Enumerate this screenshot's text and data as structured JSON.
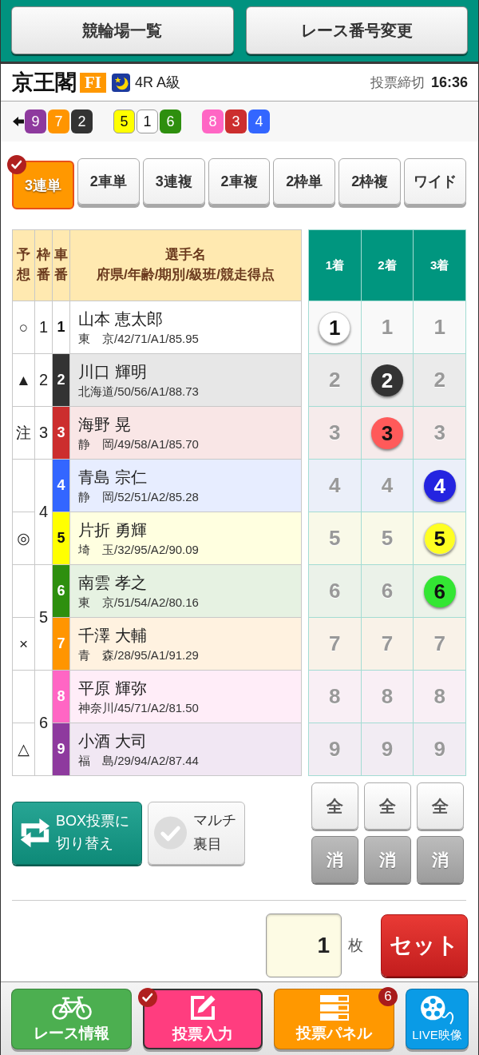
{
  "top_buttons": [
    {
      "label": "競輪場一覧"
    },
    {
      "label": "レース番号変更"
    }
  ],
  "race_header": {
    "venue": "京王閣",
    "grade": "FI",
    "night_race": true,
    "race": "4R A級",
    "deadline_label": "投票締切",
    "deadline_time": "16:36"
  },
  "lineup": {
    "groups": [
      {
        "bikes": [
          {
            "number": "9",
            "color": "#8e3a9e"
          },
          {
            "number": "7",
            "color": "#ff9500"
          },
          {
            "number": "2",
            "color": "#333333"
          }
        ]
      },
      {
        "bikes": [
          {
            "number": "5",
            "color": "#ffff00"
          },
          {
            "number": "1",
            "color": "#ffffff"
          },
          {
            "number": "6",
            "color": "#2e8f0e"
          }
        ]
      },
      {
        "bikes": [
          {
            "number": "8",
            "color": "#ff66c4"
          },
          {
            "number": "3",
            "color": "#cc2e2e"
          },
          {
            "number": "4",
            "color": "#3366ff"
          }
        ]
      }
    ]
  },
  "bet_types": [
    {
      "label": "3連単",
      "selected": true
    },
    {
      "label": "2車単",
      "selected": false
    },
    {
      "label": "3連複",
      "selected": false
    },
    {
      "label": "2車複",
      "selected": false
    },
    {
      "label": "2枠単",
      "selected": false
    },
    {
      "label": "2枠複",
      "selected": false
    },
    {
      "label": "ワイド",
      "selected": false
    }
  ],
  "entries": {
    "columns": [
      {
        "label": "予想"
      },
      {
        "label": "枠番"
      },
      {
        "label": "車番"
      },
      {
        "label": "選手名",
        "sublabel": "府県/年齢/期別/級班/競走得点"
      }
    ],
    "frames": [
      {
        "frame": "1",
        "riders": [
          {
            "prediction": "○",
            "bike": "1",
            "color": "#ffffff",
            "name": "山本 恵太郎",
            "info": "東　京/42/71/A1/85.95"
          }
        ]
      },
      {
        "frame": "2",
        "riders": [
          {
            "prediction": "▲",
            "bike": "2",
            "color": "#333333",
            "name": "川口 輝明",
            "info": "北海道/50/56/A1/88.73"
          }
        ]
      },
      {
        "frame": "3",
        "riders": [
          {
            "prediction": "注",
            "bike": "3",
            "color": "#cc2e2e",
            "name": "海野 晃",
            "info": "静　岡/49/58/A1/85.70"
          }
        ]
      },
      {
        "frame": "4",
        "riders": [
          {
            "bike": "4",
            "color": "#3366ff",
            "name": "青島 宗仁",
            "info": "静　岡/52/51/A2/85.28"
          },
          {
            "prediction": "◎",
            "bike": "5",
            "color": "#ffff00",
            "name": "片折 勇輝",
            "info": "埼　玉/32/95/A2/90.09"
          }
        ]
      },
      {
        "frame": "5",
        "riders": [
          {
            "bike": "6",
            "color": "#2e8f0e",
            "name": "南雲 孝之",
            "info": "東　京/51/54/A2/80.16"
          },
          {
            "prediction": "×",
            "bike": "7",
            "color": "#ff9500",
            "name": "千澤 大輔",
            "info": "青　森/28/95/A1/91.29"
          }
        ]
      },
      {
        "frame": "6",
        "riders": [
          {
            "bike": "8",
            "color": "#ff66c4",
            "name": "平原 輝弥",
            "info": "神奈川/45/71/A2/81.50"
          },
          {
            "prediction": "△",
            "bike": "9",
            "color": "#8e3a9e",
            "name": "小酒 大司",
            "info": "福　島/29/94/A2/87.44"
          }
        ]
      }
    ]
  },
  "selection_grid": {
    "columns": [
      {
        "label": "1着"
      },
      {
        "label": "2着"
      },
      {
        "label": "3着"
      }
    ],
    "rows": [
      {
        "color": "#ffffff",
        "cells": [
          {
            "label": "1",
            "selected": true
          },
          {
            "label": "1",
            "selected": false
          },
          {
            "label": "1",
            "selected": false
          }
        ]
      },
      {
        "color": "#333333",
        "cells": [
          {
            "label": "2",
            "selected": false
          },
          {
            "label": "2",
            "selected": true
          },
          {
            "label": "2",
            "selected": false
          }
        ]
      },
      {
        "color": "#ff5a5a",
        "cells": [
          {
            "label": "3",
            "selected": false
          },
          {
            "label": "3",
            "selected": true
          },
          {
            "label": "3",
            "selected": false
          }
        ]
      },
      {
        "color": "#2424e0",
        "cells": [
          {
            "label": "4",
            "selected": false
          },
          {
            "label": "4",
            "selected": false
          },
          {
            "label": "4",
            "selected": true
          }
        ]
      },
      {
        "color": "#ffff22",
        "cells": [
          {
            "label": "5",
            "selected": false
          },
          {
            "label": "5",
            "selected": false
          },
          {
            "label": "5",
            "selected": true
          }
        ]
      },
      {
        "color": "#33e633",
        "cells": [
          {
            "label": "6",
            "selected": false
          },
          {
            "label": "6",
            "selected": false
          },
          {
            "label": "6",
            "selected": true
          }
        ]
      },
      {
        "cells": [
          {
            "label": "7",
            "selected": false
          },
          {
            "label": "7",
            "selected": false
          },
          {
            "label": "7",
            "selected": false
          }
        ]
      },
      {
        "cells": [
          {
            "label": "8",
            "selected": false
          },
          {
            "label": "8",
            "selected": false
          },
          {
            "label": "8",
            "selected": false
          }
        ]
      },
      {
        "cells": [
          {
            "label": "9",
            "selected": false
          },
          {
            "label": "9",
            "selected": false
          },
          {
            "label": "9",
            "selected": false
          }
        ]
      }
    ]
  },
  "column_buttons": [
    {
      "select_all": "全",
      "clear": "消"
    },
    {
      "select_all": "全",
      "clear": "消"
    },
    {
      "select_all": "全",
      "clear": "消"
    }
  ],
  "options": {
    "box_button": "BOX投票に切り替え",
    "multi": {
      "label": "マルチ裏目",
      "checked": false
    }
  },
  "order": {
    "quantity": "1",
    "unit": "枚",
    "set_button": "セット"
  },
  "bottom_nav": [
    {
      "kind": "race",
      "label": "レース情報",
      "color": "#4caf50",
      "selected": false
    },
    {
      "kind": "input",
      "label": "投票入力",
      "color": "#ff3d7f",
      "selected": true
    },
    {
      "kind": "panel",
      "label": "投票パネル",
      "color": "#ff9800",
      "selected": false,
      "badge": "6"
    },
    {
      "kind": "video",
      "label": "LIVE映像",
      "color": "#0a9be6",
      "selected": false
    }
  ]
}
